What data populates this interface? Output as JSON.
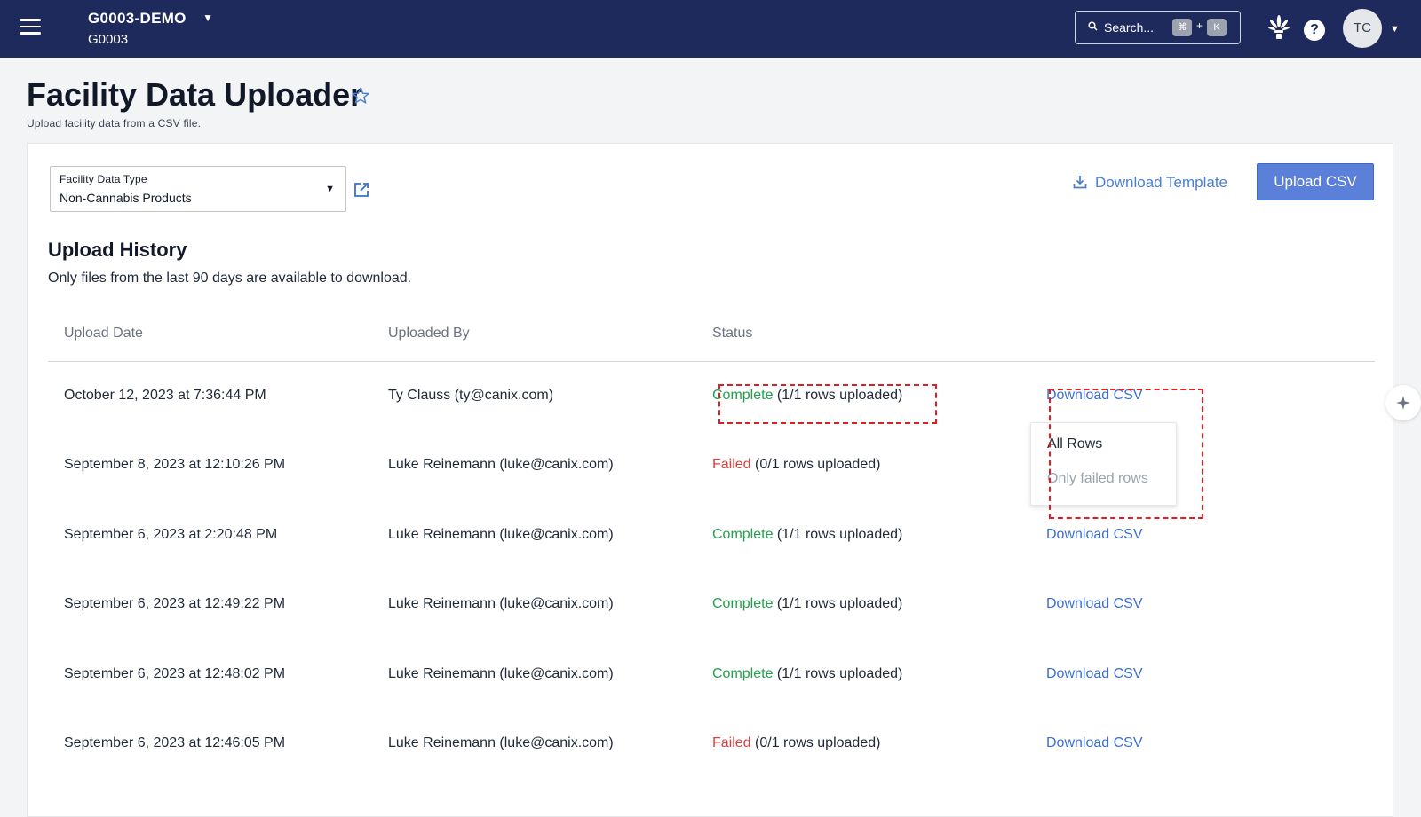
{
  "topbar": {
    "org_name": "G0003-DEMO",
    "org_id": "G0003",
    "search_placeholder": "Search...",
    "shortcut_key1": "⌘",
    "shortcut_plus": "+",
    "shortcut_key2": "K",
    "help_label": "?",
    "avatar_initials": "TC"
  },
  "page": {
    "title": "Facility Data Uploader",
    "subtitle": "Upload facility data from a CSV file."
  },
  "form": {
    "select_label": "Facility Data Type",
    "select_value": "Non-Cannabis Products",
    "download_template_label": "Download Template",
    "upload_button_label": "Upload CSV"
  },
  "history": {
    "title": "Upload History",
    "note": "Only files from the last 90 days are available to download.",
    "columns": [
      "Upload Date",
      "Uploaded By",
      "Status"
    ],
    "rows": [
      {
        "date": "October 12, 2023 at 7:36:44 PM",
        "user": "Ty Clauss (ty@canix.com)",
        "status": "Complete",
        "detail": " (1/1 rows uploaded)",
        "action": "Download CSV"
      },
      {
        "date": "September 8, 2023 at 12:10:26 PM",
        "user": "Luke Reinemann (luke@canix.com)",
        "status": "Failed",
        "detail": " (0/1 rows uploaded)",
        "action": ""
      },
      {
        "date": "September 6, 2023 at 2:20:48 PM",
        "user": "Luke Reinemann (luke@canix.com)",
        "status": "Complete",
        "detail": " (1/1 rows uploaded)",
        "action": "Download CSV"
      },
      {
        "date": "September 6, 2023 at 12:49:22 PM",
        "user": "Luke Reinemann (luke@canix.com)",
        "status": "Complete",
        "detail": " (1/1 rows uploaded)",
        "action": "Download CSV"
      },
      {
        "date": "September 6, 2023 at 12:48:02 PM",
        "user": "Luke Reinemann (luke@canix.com)",
        "status": "Complete",
        "detail": " (1/1 rows uploaded)",
        "action": "Download CSV"
      },
      {
        "date": "September 6, 2023 at 12:46:05 PM",
        "user": "Luke Reinemann (luke@canix.com)",
        "status": "Failed",
        "detail": " (0/1 rows uploaded)",
        "action": "Download CSV"
      }
    ]
  },
  "download_menu": {
    "all_rows": "All Rows",
    "only_failed": "Only failed rows"
  },
  "colors": {
    "topbar": "#1f2a5c",
    "accent": "#5b80d9",
    "link": "#3b6fd4",
    "complete": "#22a04b",
    "failed": "#e03e3e",
    "highlight": "#e11d24"
  }
}
